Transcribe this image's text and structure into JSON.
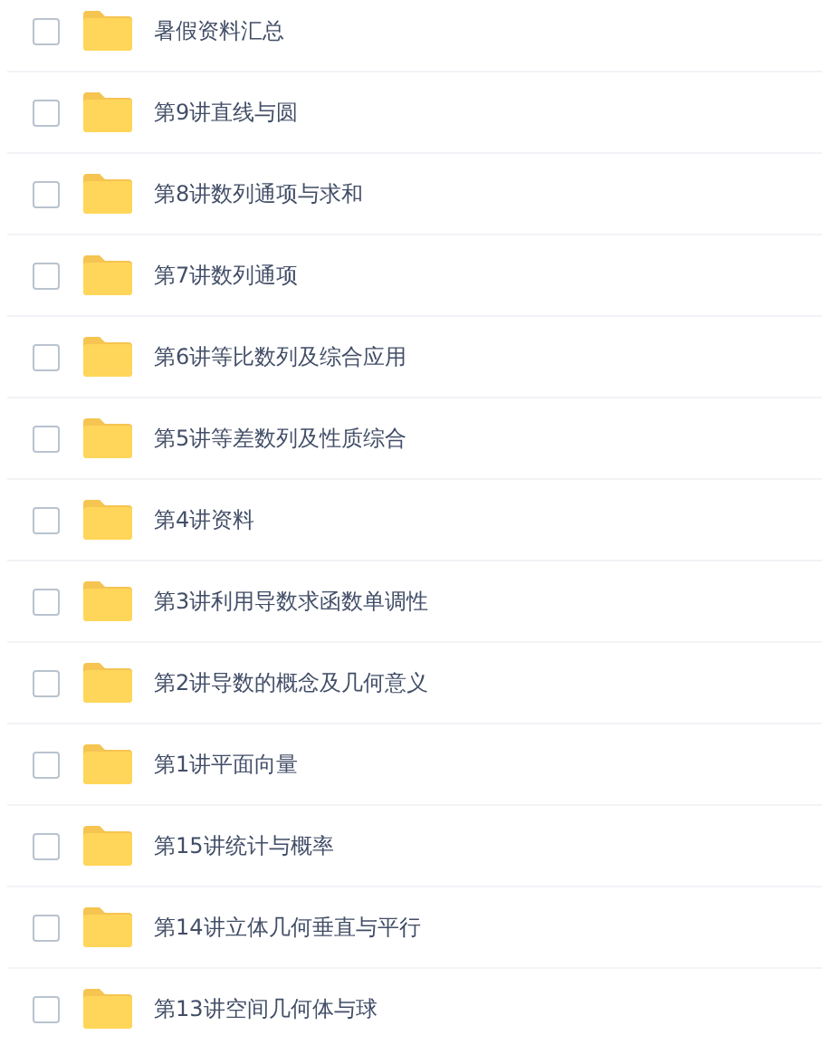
{
  "files": [
    {
      "name": "暑假资料汇总",
      "checked": false
    },
    {
      "name": "第9讲直线与圆",
      "checked": false
    },
    {
      "name": "第8讲数列通项与求和",
      "checked": false
    },
    {
      "name": "第7讲数列通项",
      "checked": false
    },
    {
      "name": "第6讲等比数列及综合应用",
      "checked": false
    },
    {
      "name": "第5讲等差数列及性质综合",
      "checked": false
    },
    {
      "name": "第4讲资料",
      "checked": false
    },
    {
      "name": "第3讲利用导数求函数单调性",
      "checked": false
    },
    {
      "name": "第2讲导数的概念及几何意义",
      "checked": false
    },
    {
      "name": "第1讲平面向量",
      "checked": false
    },
    {
      "name": "第15讲统计与概率",
      "checked": false
    },
    {
      "name": "第14讲立体几何垂直与平行",
      "checked": false
    },
    {
      "name": "第13讲空间几何体与球",
      "checked": false
    }
  ]
}
